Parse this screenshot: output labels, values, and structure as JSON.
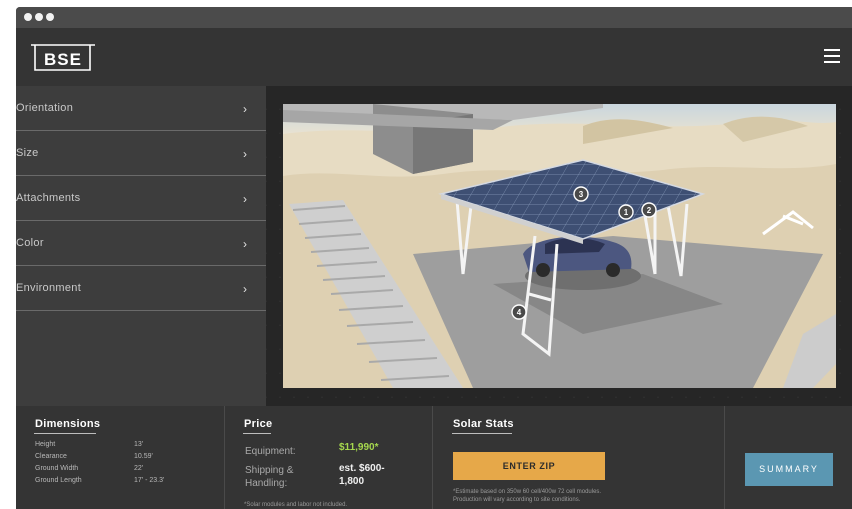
{
  "app": {
    "logo_text": "BSE"
  },
  "sidebar": {
    "items": [
      {
        "label": "Orientation",
        "chevron": "›"
      },
      {
        "label": "Size",
        "chevron": "›"
      },
      {
        "label": "Attachments",
        "chevron": "›"
      },
      {
        "label": "Color",
        "chevron": "›"
      },
      {
        "label": "Environment",
        "chevron": "›"
      }
    ]
  },
  "viewer": {
    "markers": [
      "1",
      "2",
      "3",
      "4"
    ]
  },
  "dimensions": {
    "title": "Dimensions",
    "rows": [
      {
        "label": "Height",
        "value": "13'"
      },
      {
        "label": "Clearance",
        "value": "10.59'"
      },
      {
        "label": "Ground Width",
        "value": "22'"
      },
      {
        "label": "Ground Length",
        "value": "17' - 23.3'"
      }
    ]
  },
  "price": {
    "title": "Price",
    "equipment_label": "Equipment:",
    "equipment_value": "$11,990*",
    "shipping_label_1": "Shipping &",
    "shipping_label_2": "Handling:",
    "shipping_value_1": "est. $600-",
    "shipping_value_2": "1,800",
    "footnote": "*Solar modules and labor not included."
  },
  "solar": {
    "title": "Solar Stats",
    "zip_button": "ENTER ZIP",
    "footnote_1": "*Estimate based on 350w 60 cell/400w 72 cell modules.",
    "footnote_2": "Production will vary according to site conditions."
  },
  "summary": {
    "button": "SUMMARY"
  },
  "colors": {
    "accent_orange": "#e6a849",
    "accent_blue": "#5b97b2",
    "price_green": "#a6d84e"
  }
}
